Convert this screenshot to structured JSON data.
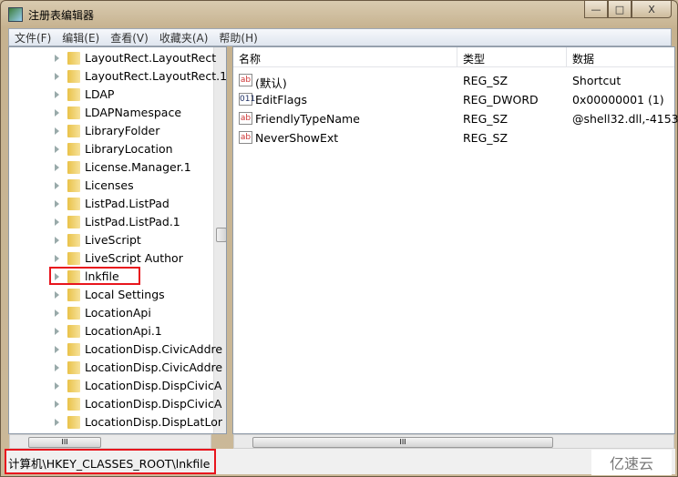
{
  "window": {
    "title": "注册表编辑器",
    "minimize": "—",
    "maximize": "□",
    "close": "X"
  },
  "menu": [
    "文件(F)",
    "编辑(E)",
    "查看(V)",
    "收藏夹(A)",
    "帮助(H)"
  ],
  "tree": {
    "items": [
      "LayoutRect.LayoutRect",
      "LayoutRect.LayoutRect.1",
      "LDAP",
      "LDAPNamespace",
      "LibraryFolder",
      "LibraryLocation",
      "License.Manager.1",
      "Licenses",
      "ListPad.ListPad",
      "ListPad.ListPad.1",
      "LiveScript",
      "LiveScript Author",
      "lnkfile",
      "Local Settings",
      "LocationApi",
      "LocationApi.1",
      "LocationDisp.CivicAddre",
      "LocationDisp.CivicAddre",
      "LocationDisp.DispCivicA",
      "LocationDisp.DispCivicA",
      "LocationDisp.DispLatLor"
    ],
    "selected": "lnkfile"
  },
  "list": {
    "columns": [
      "名称",
      "类型",
      "数据"
    ],
    "rows": [
      {
        "icon": "string-value-icon",
        "name": "(默认)",
        "type": "REG_SZ",
        "data": "Shortcut"
      },
      {
        "icon": "binary-value-icon",
        "name": "EditFlags",
        "type": "REG_DWORD",
        "data": "0x00000001 (1)"
      },
      {
        "icon": "string-value-icon",
        "name": "FriendlyTypeName",
        "type": "REG_SZ",
        "data": "@shell32.dll,-4153"
      },
      {
        "icon": "string-value-icon",
        "name": "NeverShowExt",
        "type": "REG_SZ",
        "data": ""
      }
    ]
  },
  "status": {
    "path": "计算机\\HKEY_CLASSES_ROOT\\lnkfile"
  },
  "watermark": "亿速云",
  "colors": {
    "highlight": "#e8151d"
  }
}
